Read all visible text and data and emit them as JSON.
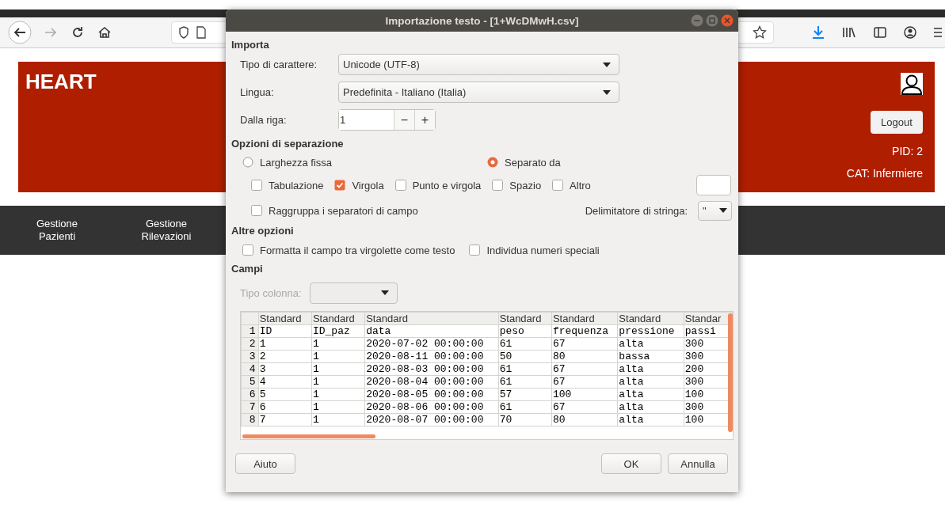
{
  "page": {
    "title": "HEART",
    "logout": "Logout",
    "pid": "PID: 2",
    "category": "CAT: Infermiere",
    "nav": [
      {
        "label": "Gestione Pazienti"
      },
      {
        "label": "Gestione Rilevazioni"
      }
    ]
  },
  "dialog": {
    "title": "Importazione testo - [1+WcDMwH.csv]",
    "import": {
      "heading": "Importa",
      "charset": {
        "label": "Tipo di carattere:",
        "value": "Unicode (UTF-8)"
      },
      "language": {
        "label": "Lingua:",
        "value": "Predefinita - Italiano (Italia)"
      },
      "from_row": {
        "label": "Dalla riga:",
        "value": "1",
        "minus": "−",
        "plus": "+"
      }
    },
    "separation": {
      "heading": "Opzioni di separazione",
      "modes": [
        {
          "label": "Larghezza fissa",
          "selected": false
        },
        {
          "label": "Separato da",
          "selected": true
        }
      ],
      "separators": [
        {
          "label": "Tabulazione",
          "checked": false
        },
        {
          "label": "Virgola",
          "checked": true
        },
        {
          "label": "Punto e virgola",
          "checked": false
        },
        {
          "label": "Spazio",
          "checked": false
        },
        {
          "label": "Altro",
          "checked": false
        }
      ],
      "merge": {
        "label": "Raggruppa i separatori di campo",
        "checked": false
      },
      "string_delimiter": {
        "label": "Delimitatore di stringa:",
        "value": "\""
      }
    },
    "other_options": {
      "heading": "Altre opzioni",
      "options": [
        {
          "label": "Formatta il campo tra virgolette come testo",
          "checked": false
        },
        {
          "label": "Individua numeri speciali",
          "checked": false
        }
      ]
    },
    "fields": {
      "heading": "Campi",
      "column_type": {
        "label": "Tipo colonna:",
        "disabled": true
      },
      "column_types": [
        "Standard",
        "Standard",
        "Standard",
        "Standard",
        "Standard",
        "Standard",
        "Standar"
      ],
      "rows": [
        {
          "number": "1",
          "cells": [
            "ID",
            "ID_paz",
            "data",
            "peso",
            "frequenza",
            "pressione",
            "passi"
          ]
        },
        {
          "number": "2",
          "cells": [
            "1",
            "1",
            "2020-07-02 00:00:00",
            "61",
            "67",
            "alta",
            "300"
          ]
        },
        {
          "number": "3",
          "cells": [
            "2",
            "1",
            "2020-08-11 00:00:00",
            "50",
            "80",
            "bassa",
            "300"
          ]
        },
        {
          "number": "4",
          "cells": [
            "3",
            "1",
            "2020-08-03 00:00:00",
            "61",
            "67",
            "alta",
            "200"
          ]
        },
        {
          "number": "5",
          "cells": [
            "4",
            "1",
            "2020-08-04 00:00:00",
            "61",
            "67",
            "alta",
            "300"
          ]
        },
        {
          "number": "6",
          "cells": [
            "5",
            "1",
            "2020-08-05 00:00:00",
            "57",
            "100",
            "alta",
            "100"
          ]
        },
        {
          "number": "7",
          "cells": [
            "6",
            "1",
            "2020-08-06 00:00:00",
            "61",
            "67",
            "alta",
            "300"
          ]
        },
        {
          "number": "8",
          "cells": [
            "7",
            "1",
            "2020-08-07 00:00:00",
            "70",
            "80",
            "alta",
            "100"
          ]
        }
      ]
    },
    "buttons": {
      "help": "Aiuto",
      "ok": "OK",
      "cancel": "Annulla"
    }
  }
}
